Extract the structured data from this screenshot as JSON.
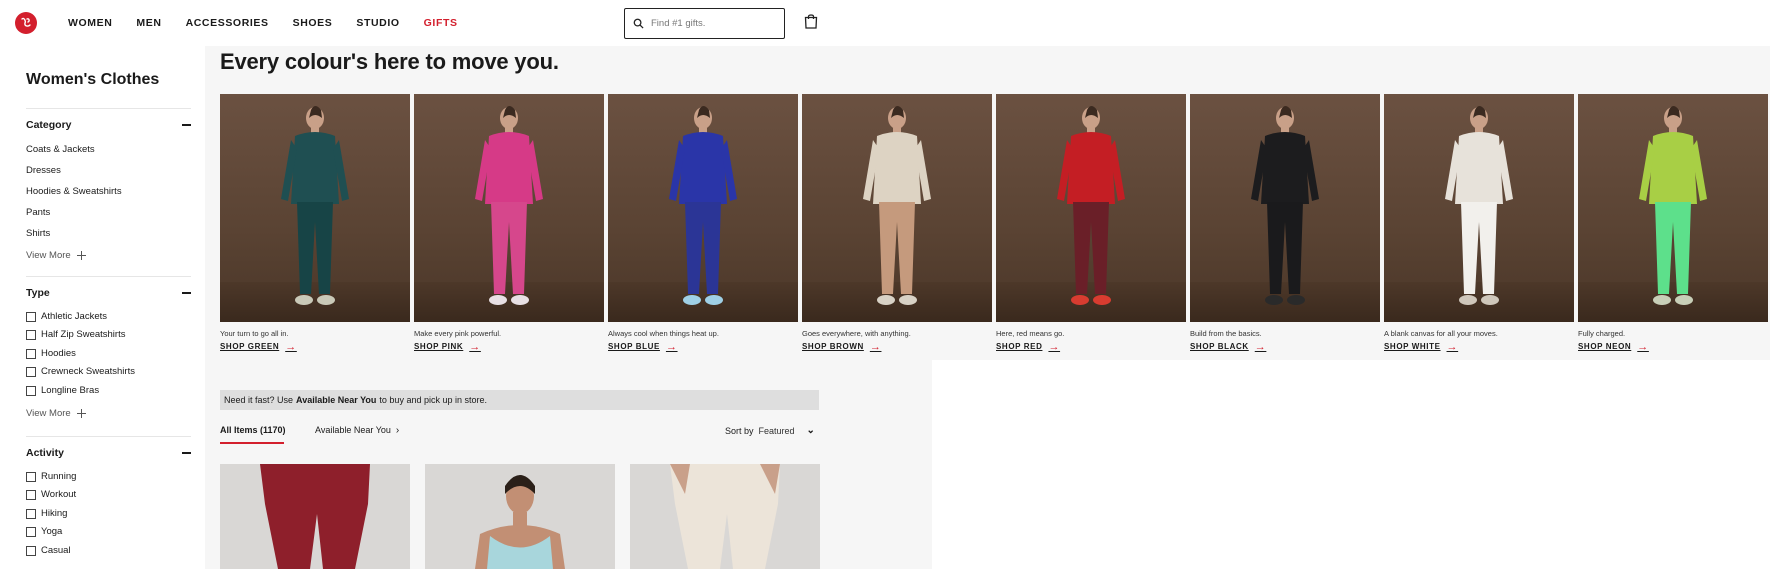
{
  "header": {
    "nav": [
      "WOMEN",
      "MEN",
      "ACCESSORIES",
      "SHOES",
      "STUDIO",
      "GIFTS"
    ],
    "search_placeholder": "Find #1 gifts."
  },
  "sidebar": {
    "title": "Women's Clothes",
    "category": {
      "heading": "Category",
      "links": [
        "Coats & Jackets",
        "Dresses",
        "Hoodies & Sweatshirts",
        "Pants",
        "Shirts"
      ],
      "view_more": "View More"
    },
    "type": {
      "heading": "Type",
      "options": [
        "Athletic Jackets",
        "Half Zip Sweatshirts",
        "Hoodies",
        "Crewneck Sweatshirts",
        "Longline Bras"
      ],
      "view_more": "View More"
    },
    "activity": {
      "heading": "Activity",
      "options": [
        "Running",
        "Workout",
        "Hiking",
        "Yoga",
        "Casual"
      ]
    }
  },
  "main": {
    "headline": "Every colour's here to move you.",
    "colours": [
      {
        "tagline": "Your turn to go all in.",
        "shop": "SHOP GREEN",
        "top": "#1f4f52",
        "bottom": "#174446",
        "shoe": "#c9c9b8"
      },
      {
        "tagline": "Make every pink powerful.",
        "shop": "SHOP PINK",
        "top": "#d63a87",
        "bottom": "#d6478c",
        "shoe": "#e8e0e4"
      },
      {
        "tagline": "Always cool when things heat up.",
        "shop": "SHOP BLUE",
        "top": "#2a35a8",
        "bottom": "#2b3596",
        "shoe": "#9fd0e6"
      },
      {
        "tagline": "Goes everywhere, with anything.",
        "shop": "SHOP BROWN",
        "top": "#ddd3c3",
        "bottom": "#c59a7d",
        "shoe": "#d8d2c6"
      },
      {
        "tagline": "Here, red means go.",
        "shop": "SHOP RED",
        "top": "#c41e24",
        "bottom": "#6a1f28",
        "shoe": "#d83c30"
      },
      {
        "tagline": "Build from the basics.",
        "shop": "SHOP BLACK",
        "top": "#1c1c1e",
        "bottom": "#1a1a1c",
        "shoe": "#2a2a2a"
      },
      {
        "tagline": "A blank canvas for all your moves.",
        "shop": "SHOP WHITE",
        "top": "#e7e2da",
        "bottom": "#f2f0ec",
        "shoe": "#cfc7bb"
      },
      {
        "tagline": "Fully charged.",
        "shop": "SHOP NEON",
        "top": "#a8cf45",
        "bottom": "#5de08b",
        "shoe": "#c8cfb8"
      }
    ],
    "notice": {
      "prefix": "Need it fast? Use",
      "bold": "Available Near You",
      "suffix": "to buy and pick up in store."
    },
    "tabs": {
      "all_items": "All Items (1170)",
      "available": "Available Near You"
    },
    "sort": {
      "label": "Sort by",
      "value": "Featured"
    },
    "products": [
      {
        "color": "#8e1f2b"
      },
      {
        "color": "#a8d6dc"
      },
      {
        "color": "#ece4d9"
      }
    ]
  },
  "colors": {
    "brand_red": "#d31f2d",
    "panel_grey": "#f6f6f6"
  }
}
